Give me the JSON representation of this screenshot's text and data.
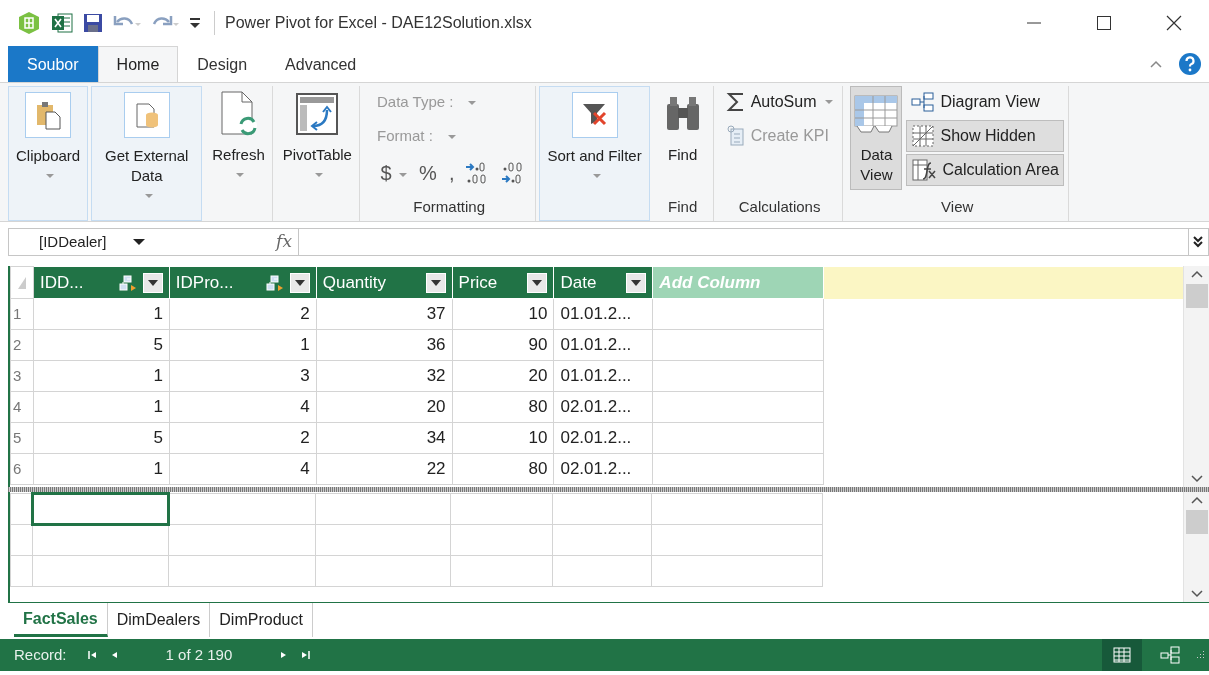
{
  "window": {
    "title": "Power Pivot for Excel - DAE12Solution.xlsx"
  },
  "ribbon_tabs": [
    {
      "label": "Soubor",
      "kind": "file",
      "selected": false
    },
    {
      "label": "Home",
      "kind": "tab",
      "selected": true
    },
    {
      "label": "Design",
      "kind": "tab",
      "selected": false
    },
    {
      "label": "Advanced",
      "kind": "tab",
      "selected": false
    }
  ],
  "ribbon_groups": [
    {
      "columns": [
        {
          "items": [
            {
              "kind": "large",
              "label": "Clipboard",
              "dropdown": true,
              "highlighted": true
            }
          ]
        }
      ]
    },
    {
      "columns": [
        {
          "items": [
            {
              "kind": "large",
              "label": "Get External Data",
              "dropdown": true,
              "highlighted": true
            }
          ]
        }
      ]
    },
    {
      "columns": [
        {
          "items": [
            {
              "kind": "large",
              "label": "Refresh",
              "dropdown": true,
              "highlighted": false
            }
          ]
        }
      ]
    },
    {
      "columns": [
        {
          "items": [
            {
              "kind": "large",
              "label": "PivotTable",
              "dropdown": true,
              "highlighted": false
            }
          ]
        }
      ]
    },
    {
      "label": "Formatting",
      "columns": [
        {
          "items": [
            {
              "kind": "field",
              "label": "Data Type :",
              "disabled": true
            },
            {
              "kind": "field",
              "label": "Format :",
              "disabled": true
            },
            {
              "kind": "symbol_row",
              "symbols": [
                {
                  "kind": "text",
                  "text": "$",
                  "dropdown": true
                },
                {
                  "kind": "text",
                  "text": "%",
                  "dropdown": false
                },
                {
                  "kind": "text",
                  "text": ",",
                  "dropdown": false
                },
                {
                  "kind": "icon"
                },
                {
                  "kind": "icon"
                }
              ]
            }
          ]
        }
      ]
    },
    {
      "columns": [
        {
          "items": [
            {
              "kind": "large",
              "label": "Sort and Filter",
              "dropdown": true,
              "highlighted": true
            }
          ]
        }
      ]
    },
    {
      "label": "Find",
      "columns": [
        {
          "items": [
            {
              "kind": "large",
              "label": "Find",
              "dropdown": false,
              "highlighted": false
            }
          ]
        }
      ]
    },
    {
      "label": "Calculations",
      "columns": [
        {
          "items": [
            {
              "kind": "small",
              "label": "AutoSum",
              "dropdown": true,
              "disabled": false,
              "selected": false
            },
            {
              "kind": "small",
              "label": "Create KPI",
              "dropdown": false,
              "disabled": true,
              "selected": false
            }
          ]
        }
      ]
    },
    {
      "label": "View",
      "columns": [
        {
          "items": [
            {
              "kind": "large",
              "label": "Data View",
              "dropdown": false,
              "highlighted": false,
              "selected": true
            }
          ]
        },
        {
          "items": [
            {
              "kind": "small",
              "label": "Diagram View",
              "dropdown": false,
              "disabled": false,
              "selected": false
            },
            {
              "kind": "small",
              "label": "Show Hidden",
              "dropdown": false,
              "disabled": false,
              "selected": true
            },
            {
              "kind": "small",
              "label": "Calculation Area",
              "dropdown": false,
              "disabled": false,
              "selected": true
            }
          ]
        }
      ]
    }
  ],
  "formula_bar": {
    "name_box": "[IDDealer]",
    "fx": "fx"
  },
  "table": {
    "columns": [
      {
        "label": "IDD...",
        "related": true
      },
      {
        "label": "IDPro...",
        "related": true
      },
      {
        "label": "Quantity",
        "related": false
      },
      {
        "label": "Price",
        "related": false
      },
      {
        "label": "Date",
        "related": false
      }
    ],
    "add_column": "Add Column",
    "rows": [
      {
        "number": "1",
        "cells": [
          "1",
          "2",
          "37",
          "10",
          "01.01.2..."
        ]
      },
      {
        "number": "2",
        "cells": [
          "5",
          "1",
          "36",
          "90",
          "01.01.2..."
        ]
      },
      {
        "number": "3",
        "cells": [
          "1",
          "3",
          "32",
          "20",
          "01.01.2..."
        ]
      },
      {
        "number": "4",
        "cells": [
          "1",
          "4",
          "20",
          "80",
          "02.01.2..."
        ]
      },
      {
        "number": "5",
        "cells": [
          "5",
          "2",
          "34",
          "10",
          "02.01.2..."
        ]
      },
      {
        "number": "6",
        "cells": [
          "1",
          "4",
          "22",
          "80",
          "02.01.2..."
        ]
      }
    ]
  },
  "calc_area": {
    "rows": [
      {
        "cells": [
          {
            "selected": true
          },
          {
            "selected": false
          },
          {
            "selected": false
          },
          {
            "selected": false
          },
          {
            "selected": false
          },
          {
            "selected": false
          }
        ]
      },
      {
        "cells": [
          {
            "selected": false
          },
          {
            "selected": false
          },
          {
            "selected": false
          },
          {
            "selected": false
          },
          {
            "selected": false
          },
          {
            "selected": false
          }
        ]
      },
      {
        "cells": [
          {
            "selected": false
          },
          {
            "selected": false
          },
          {
            "selected": false
          },
          {
            "selected": false
          },
          {
            "selected": false
          },
          {
            "selected": false
          }
        ]
      }
    ]
  },
  "sheet_tabs": [
    {
      "label": "FactSales",
      "selected": true
    },
    {
      "label": "DimDealers",
      "selected": false
    },
    {
      "label": "DimProduct",
      "selected": false
    }
  ],
  "status_bar": {
    "record_label": "Record:",
    "position": "1 of 2 190"
  }
}
